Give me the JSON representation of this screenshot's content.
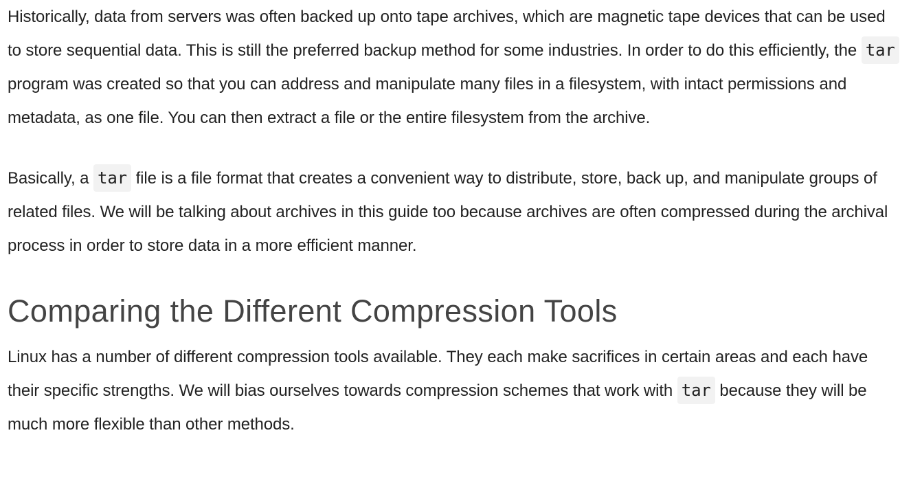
{
  "article": {
    "para1": {
      "t1": "Historically, data from servers was often backed up onto tape archives, which are magnetic tape devices that can be used to store sequential data. This is still the preferred backup method for some industries. In order to do this efficiently, the ",
      "code1": "tar",
      "t2": " program was created so that you can address and manipulate many files in a filesystem, with intact permissions and metadata, as one file. You can then extract a file or the entire filesystem from the archive."
    },
    "para2": {
      "t1": "Basically, a ",
      "code1": "tar",
      "t2": " file is a file format that creates a convenient way to distribute, store, back up, and manipulate groups of related files. We will be talking about archives in this guide too because archives are often compressed during the archival process in order to store data in a more efficient manner."
    },
    "heading": "Comparing the Different Compression Tools",
    "para3": {
      "t1": "Linux has a number of different compression tools available. They each make sacrifices in certain areas and each have their specific strengths. We will bias ourselves towards compression schemes that work with ",
      "code1": "tar",
      "t2": " because they will be much more flexible than other methods."
    }
  }
}
